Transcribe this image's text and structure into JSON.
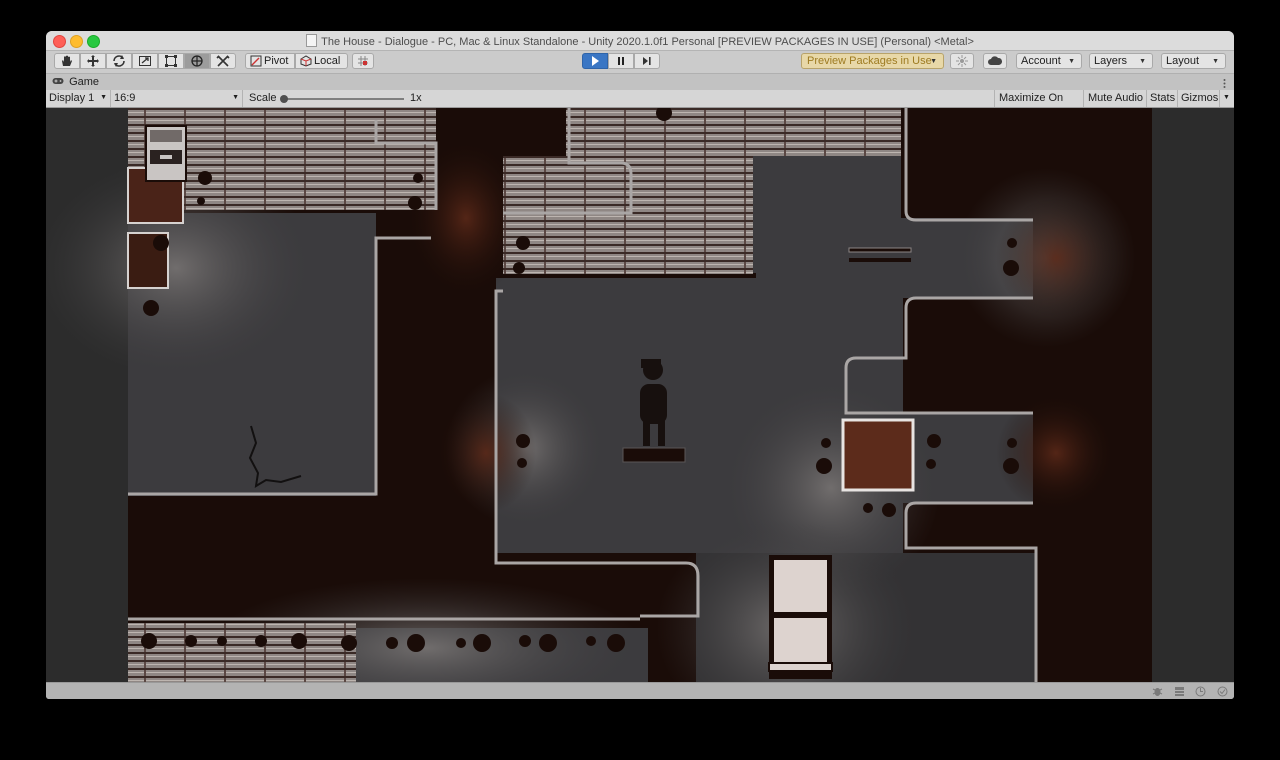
{
  "window": {
    "title": "The House - Dialogue - PC, Mac & Linux Standalone - Unity 2020.1.0f1 Personal [PREVIEW PACKAGES IN USE] (Personal) <Metal>"
  },
  "toolbar": {
    "tools": [
      {
        "name": "hand-icon"
      },
      {
        "name": "move-icon"
      },
      {
        "name": "rotate-icon"
      },
      {
        "name": "scale-icon"
      },
      {
        "name": "rect-tool-icon"
      },
      {
        "name": "transform-icon"
      },
      {
        "name": "custom-tool-icon"
      }
    ],
    "pivot_label": "Pivot",
    "local_label": "Local",
    "preview_packages_label": "Preview Packages in Use",
    "account_label": "Account",
    "layers_label": "Layers",
    "layout_label": "Layout",
    "accent_color": "#3a76c4",
    "preview_color": "#9e7b21"
  },
  "tab": {
    "label": "Game"
  },
  "game_bar": {
    "display": "Display 1",
    "aspect": "16:9",
    "scale_label": "Scale",
    "scale_value": "1x",
    "scale_slider_fraction": 0.0,
    "maximize_on_play": "Maximize On Play",
    "mute_audio": "Mute Audio",
    "stats": "Stats",
    "gizmos": "Gizmos"
  },
  "scene": {
    "floor_color": "#3b3a3c",
    "void_color": "#1a0c08",
    "wall_color": "#a5a3a3",
    "glow_color": "#4a2318"
  }
}
